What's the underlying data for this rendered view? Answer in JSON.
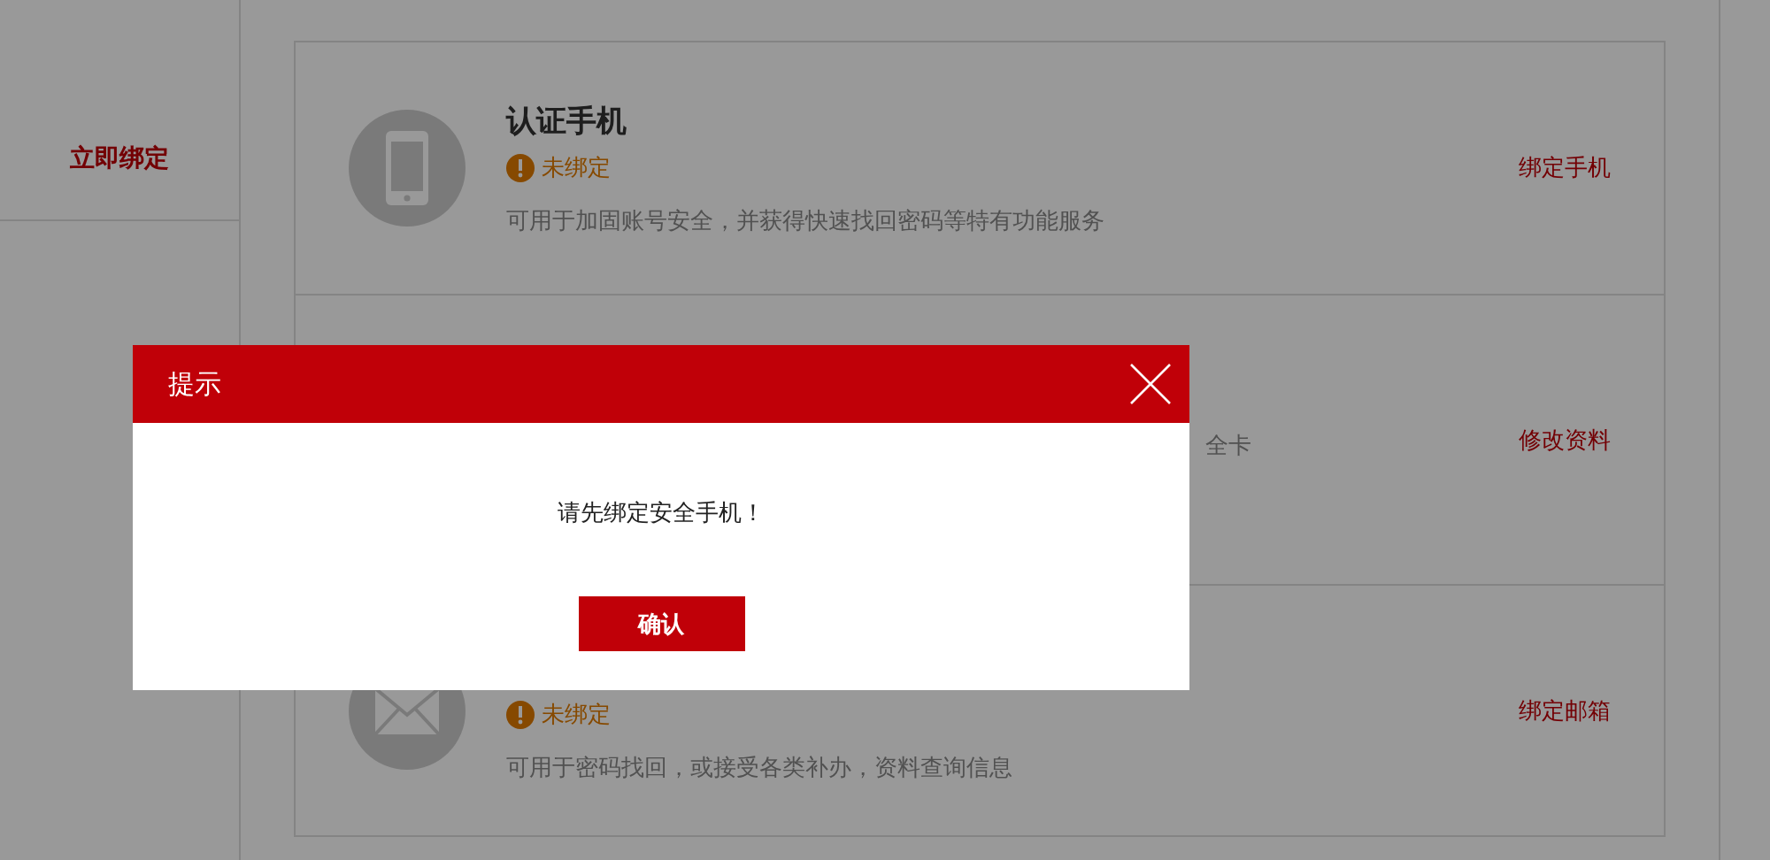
{
  "sidebar": {
    "items": [
      {
        "label": "立即绑定"
      }
    ]
  },
  "security_items": [
    {
      "kind": "phone",
      "title": "认证手机",
      "status": "未绑定",
      "description": "可用于加固账号安全，并获得快速找回密码等特有功能服务",
      "action": "绑定手机"
    },
    {
      "kind": "hidden",
      "description": "全卡",
      "action": "修改资料"
    },
    {
      "kind": "mail",
      "status": "未绑定",
      "description": "可用于密码找回，或接受各类补办，资料查询信息",
      "action": "绑定邮箱"
    }
  ],
  "dialog": {
    "title": "提示",
    "message": "请先绑定安全手机！",
    "confirm": "确认"
  }
}
